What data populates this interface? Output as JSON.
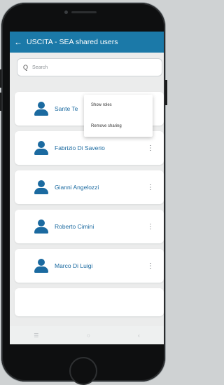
{
  "app": {
    "title": "USCITA - SEA  shared users",
    "back_icon": "arrow-left-icon"
  },
  "search": {
    "placeholder": "Search",
    "icon": "search-icon"
  },
  "users": [
    {
      "name": "Sante Te"
    },
    {
      "name": "Fabrizio  Di Saverio"
    },
    {
      "name": "Gianni Angelozzi"
    },
    {
      "name": "Roberto Cimini"
    },
    {
      "name": "Marco Di Luigi"
    }
  ],
  "menu": {
    "items": [
      {
        "label": "Show roles"
      },
      {
        "label": "Remove sharing"
      }
    ]
  },
  "colors": {
    "appbar": "#1b79a8",
    "accent": "#1b6aa0",
    "background": "#ebecec"
  },
  "navbar": {
    "icons": [
      "recent-apps-icon",
      "home-icon",
      "back-icon"
    ]
  }
}
